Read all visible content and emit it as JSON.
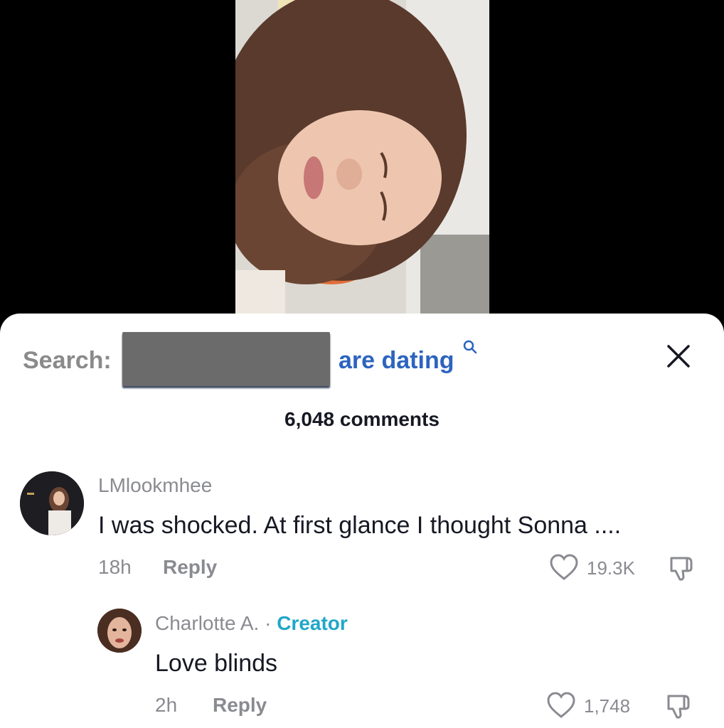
{
  "search": {
    "label": "Search:",
    "query_suffix": "are dating"
  },
  "comments_count": "6,048 comments",
  "comments": [
    {
      "username": "LMlookmhee",
      "text": "I was shocked. At first glance I thought Sonna ....",
      "time": "18h",
      "reply_label": "Reply",
      "likes": "19.3K"
    },
    {
      "username": "Charlotte A.",
      "separator": "·",
      "badge": "Creator",
      "text": "Love blinds",
      "time": "2h",
      "reply_label": "Reply",
      "likes": "1,748"
    }
  ],
  "colors": {
    "search_query": "#2d64bf",
    "creator_badge": "#20a7c8",
    "muted_text": "#8a8b91",
    "primary_text": "#161823"
  }
}
